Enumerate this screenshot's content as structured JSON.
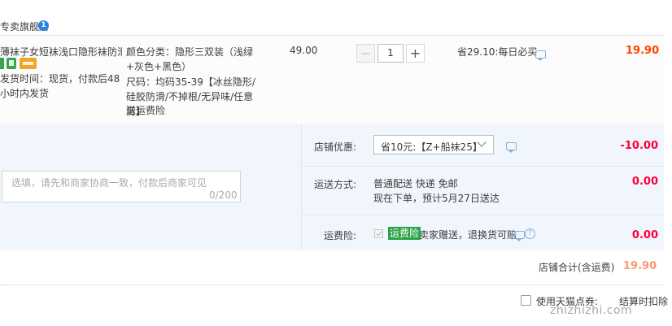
{
  "shop": {
    "name": "专卖旗舰店",
    "badge": "1"
  },
  "item": {
    "title": "薄袜子女短袜浅口隐形袜防滑...",
    "delivery": "发货时间：现货，付款后48小时内发货",
    "sku": {
      "color": "颜色分类：隐形三双装（浅绿+灰色+黑色）",
      "size": "尺码：均码35-39【冰丝隐形/硅胶防滑/不掉根/无异味/任意剪】",
      "insurance_note": "送运费险"
    },
    "unit_price": "49.00",
    "quantity": "1",
    "qty_minus": "−",
    "qty_plus": "+",
    "saving": "省29.10:每日必买",
    "subtotal": "19.90"
  },
  "order": {
    "message_placeholder": "选填，请先和商家协商一致，付款后商家可见",
    "message_count": "0/200",
    "coupon_label": "店铺优惠:",
    "coupon_value": "省10元:【Z+船袜25】",
    "coupon_amount": "-10.00",
    "shipping_label": "运送方式:",
    "shipping_method": "普通配送 快递 免邮",
    "shipping_eta": "现在下单，预计5月27日送达",
    "shipping_amount": "0.00",
    "insurance_label": "运费险:",
    "insurance_tag": "运费险",
    "insurance_desc": "卖家赠送，退换货可赔",
    "insurance_amount": "0.00",
    "help_glyph": "?"
  },
  "total": {
    "label": "店铺合计(含运费)",
    "value": "19.90"
  },
  "footer": {
    "tmall_label": "使用天猫点券:",
    "right_text": "结算时扣除"
  },
  "watermark": {
    "logo": "值|值|值",
    "url": "zhizhizhi.com"
  },
  "colors": {
    "price": "#ff4400",
    "discount": "#ff0036",
    "panel_bg": "#f1f6fd",
    "insurance_tag": "#28a448",
    "badge": "#2a82e4"
  },
  "icons": [
    "shop-badge-icon",
    "chat-bubble-icon",
    "help-icon",
    "checkbox-icon",
    "chevron-down-icon"
  ]
}
